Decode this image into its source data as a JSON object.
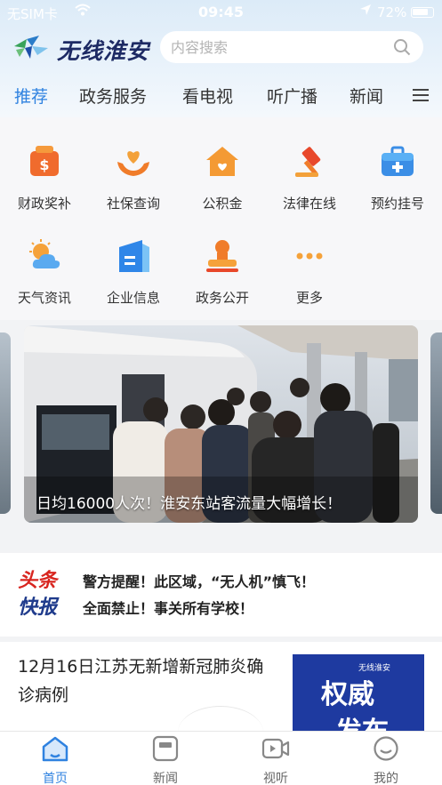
{
  "status_bar": {
    "carrier": "无SIM卡",
    "time": "09:45",
    "battery": "72%"
  },
  "header": {
    "logo_text": "无线淮安",
    "search_placeholder": "内容搜索"
  },
  "tabs": [
    {
      "label": "推荐",
      "active": true
    },
    {
      "label": "政务服务"
    },
    {
      "label": "看电视"
    },
    {
      "label": "听广播"
    },
    {
      "label": "新闻"
    }
  ],
  "services": [
    {
      "label": "财政奖补",
      "icon": "money-bag-icon"
    },
    {
      "label": "社保查询",
      "icon": "heart-hands-icon"
    },
    {
      "label": "公积金",
      "icon": "house-heart-icon"
    },
    {
      "label": "法律在线",
      "icon": "gavel-icon"
    },
    {
      "label": "预约挂号",
      "icon": "medical-kit-icon"
    },
    {
      "label": "天气资讯",
      "icon": "weather-icon"
    },
    {
      "label": "企业信息",
      "icon": "building-icon"
    },
    {
      "label": "政务公开",
      "icon": "stamp-icon"
    },
    {
      "label": "更多",
      "icon": "more-dots-icon"
    }
  ],
  "banner": {
    "caption": "日均16000人次！淮安东站客流量大幅增长！"
  },
  "headline": {
    "logo_line1": "头条",
    "logo_line2": "快报",
    "items": [
      "警方提醒！此区域，“无人机”慎飞！",
      "全面禁止！事关所有学校！"
    ]
  },
  "news": {
    "title": "12月16日江苏无新增新冠肺炎确诊病例",
    "thumb_small": "无线淮安",
    "thumb_line1": "权威",
    "thumb_line2": "发布"
  },
  "bottom_nav": [
    {
      "label": "首页",
      "active": true
    },
    {
      "label": "新闻"
    },
    {
      "label": "视听"
    },
    {
      "label": "我的"
    }
  ],
  "colors": {
    "accent": "#2f82e0",
    "orange": "#f5a23a",
    "headline_red": "#d8251f",
    "headline_blue": "#1f3b8c"
  }
}
